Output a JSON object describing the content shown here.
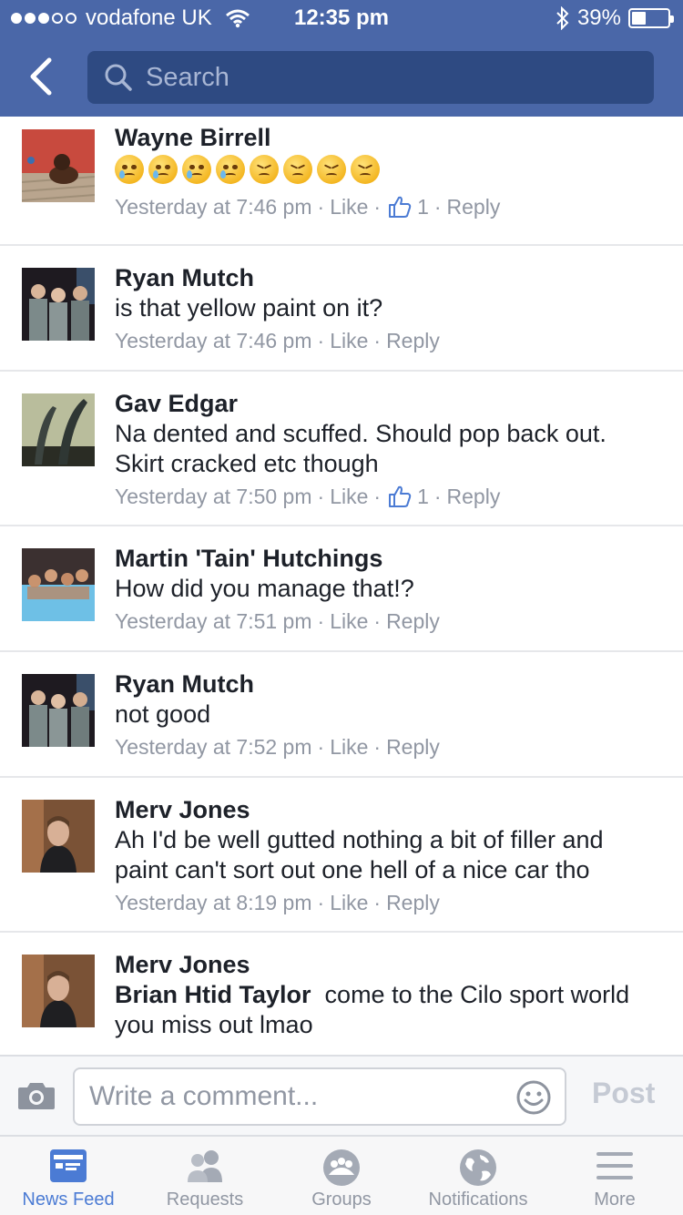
{
  "status_bar": {
    "carrier": "vodafone UK",
    "time": "12:35 pm",
    "battery": "39%",
    "battery_level": 0.39,
    "signal_bars": 3
  },
  "nav": {
    "back_icon": "chevron-left-icon",
    "search_placeholder": "Search"
  },
  "comments": [
    {
      "name": "Wayne Birrell",
      "emojis": [
        "crying",
        "crying",
        "crying",
        "crying",
        "angry",
        "angry",
        "angry",
        "angry"
      ],
      "time": "Yesterday at 7:46 pm",
      "like": "Like",
      "likes": "1",
      "reply": "Reply"
    },
    {
      "name": "Ryan Mutch",
      "text": "is that yellow paint on it?",
      "time": "Yesterday at 7:46 pm",
      "like": "Like",
      "reply": "Reply"
    },
    {
      "name": "Gav Edgar",
      "text": "Na dented and scuffed. Should pop back out. Skirt cracked etc though",
      "time": "Yesterday at 7:50 pm",
      "like": "Like",
      "likes": "1",
      "reply": "Reply"
    },
    {
      "name": "Martin 'Tain' Hutchings",
      "text": "How did you manage that!?",
      "time": "Yesterday at 7:51 pm",
      "like": "Like",
      "reply": "Reply"
    },
    {
      "name": "Ryan Mutch",
      "text": "not good",
      "time": "Yesterday at 7:52 pm",
      "like": "Like",
      "reply": "Reply"
    },
    {
      "name": "Merv Jones",
      "text": "Ah I'd be well gutted nothing a bit of filler and paint can't sort out one hell of a nice car tho",
      "time": "Yesterday at 8:19 pm",
      "like": "Like",
      "reply": "Reply"
    },
    {
      "name": "Merv Jones",
      "mention": "Brian Htid Taylor",
      "text": "come to the Cilo sport world you miss out lmao"
    }
  ],
  "composer": {
    "placeholder": "Write a comment...",
    "post_label": "Post"
  },
  "tabs": [
    {
      "label": "News Feed",
      "icon": "news-feed-icon",
      "active": true
    },
    {
      "label": "Requests",
      "icon": "friend-requests-icon",
      "active": false
    },
    {
      "label": "Groups",
      "icon": "groups-icon",
      "active": false
    },
    {
      "label": "Notifications",
      "icon": "globe-icon",
      "active": false
    },
    {
      "label": "More",
      "icon": "menu-icon",
      "active": false
    }
  ],
  "colors": {
    "header": "#4a67a8",
    "search_field": "#2e4a82",
    "active_tab": "#4b7bd4",
    "meta_text": "#9197a3"
  }
}
